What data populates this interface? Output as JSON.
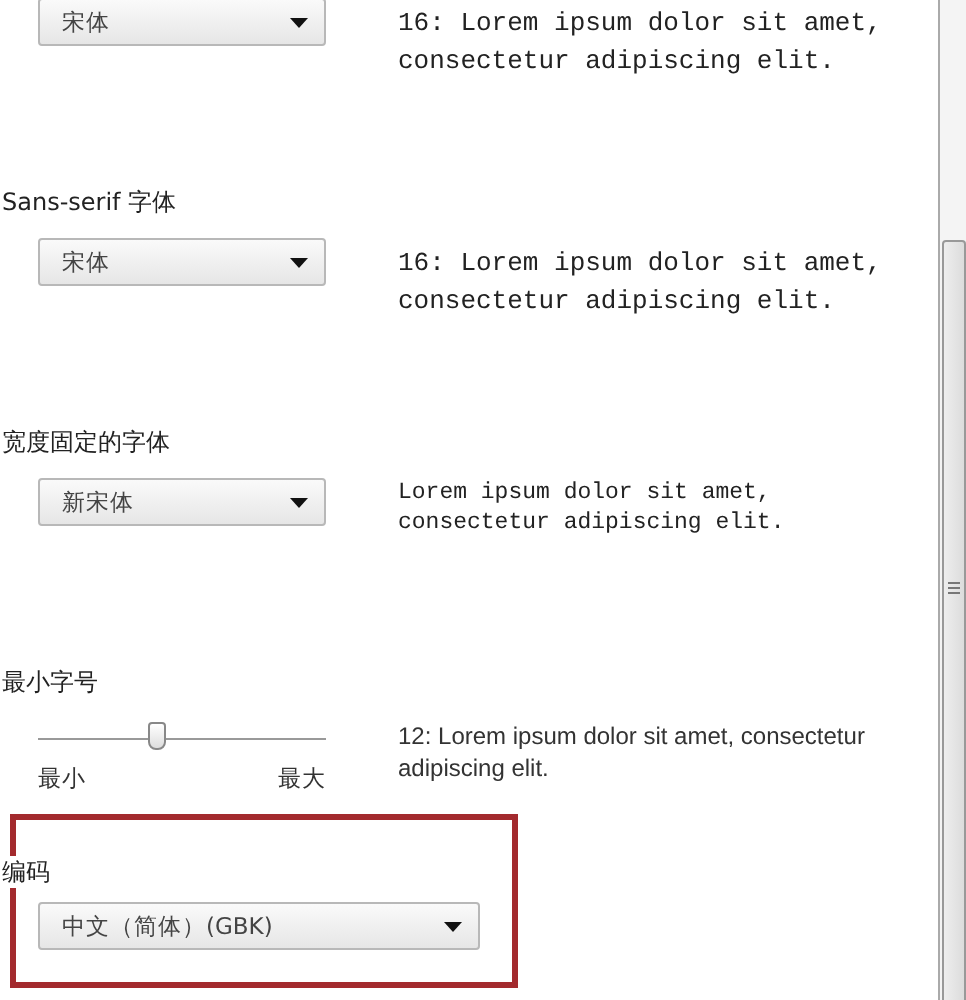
{
  "sections": [
    {
      "kind": "serif",
      "select": "宋体",
      "preview": "16: Lorem ipsum dolor sit amet, consectetur adipiscing elit."
    },
    {
      "kind": "sans",
      "label": "Sans-serif 字体",
      "select": "宋体",
      "preview": "16: Lorem ipsum dolor sit amet, consectetur adipiscing elit."
    },
    {
      "kind": "fixed",
      "label": "宽度固定的字体",
      "select": "新宋体",
      "preview": "Lorem ipsum dolor sit amet, consectetur adipiscing elit."
    },
    {
      "kind": "slider",
      "label": "最小字号",
      "level": 0.41,
      "min_label": "最小",
      "max_label": "最大",
      "preview": "12: Lorem ipsum dolor sit amet, consectetur adipiscing elit."
    },
    {
      "kind": "encoding",
      "label": "编码",
      "select": "中文（简体）(GBK)"
    }
  ]
}
